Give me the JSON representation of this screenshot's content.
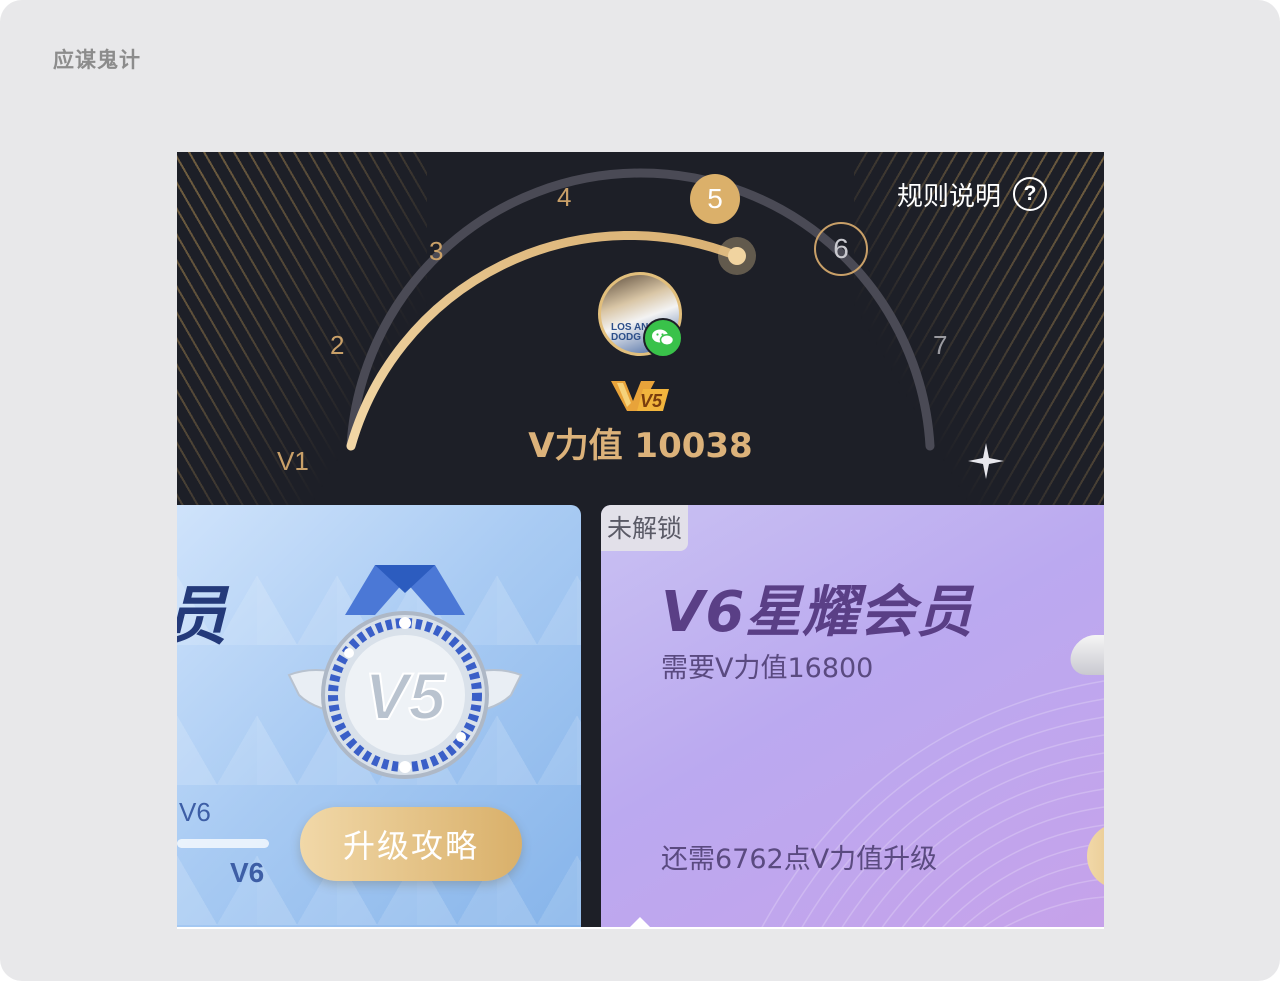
{
  "watermark": "应谋鬼计",
  "header": {
    "rules_label": "规则说明",
    "help_icon": "?",
    "levels": {
      "v1": "V1",
      "l2": "2",
      "l3": "3",
      "l4": "4",
      "current": "5",
      "next": "6",
      "l7": "7"
    },
    "vip_badge": "V5",
    "score_text": "V力值 10038",
    "progress_fraction_between_5_and_6": 0.0,
    "colors": {
      "gold": "#dbb06a",
      "background": "#1d1f27",
      "track": "#4a4a55"
    }
  },
  "avatar": {
    "caption": "LOS AN DODG"
  },
  "current_card": {
    "medal_text": "V5",
    "progress_label_top": "V6",
    "progress_label_bottom": "V6",
    "button_label": "升级攻略"
  },
  "next_card": {
    "locked_tag": "未解锁",
    "title": "V6星耀会员",
    "requirement": "需要V力值16800",
    "remaining": "还需6762点V力值升级"
  }
}
